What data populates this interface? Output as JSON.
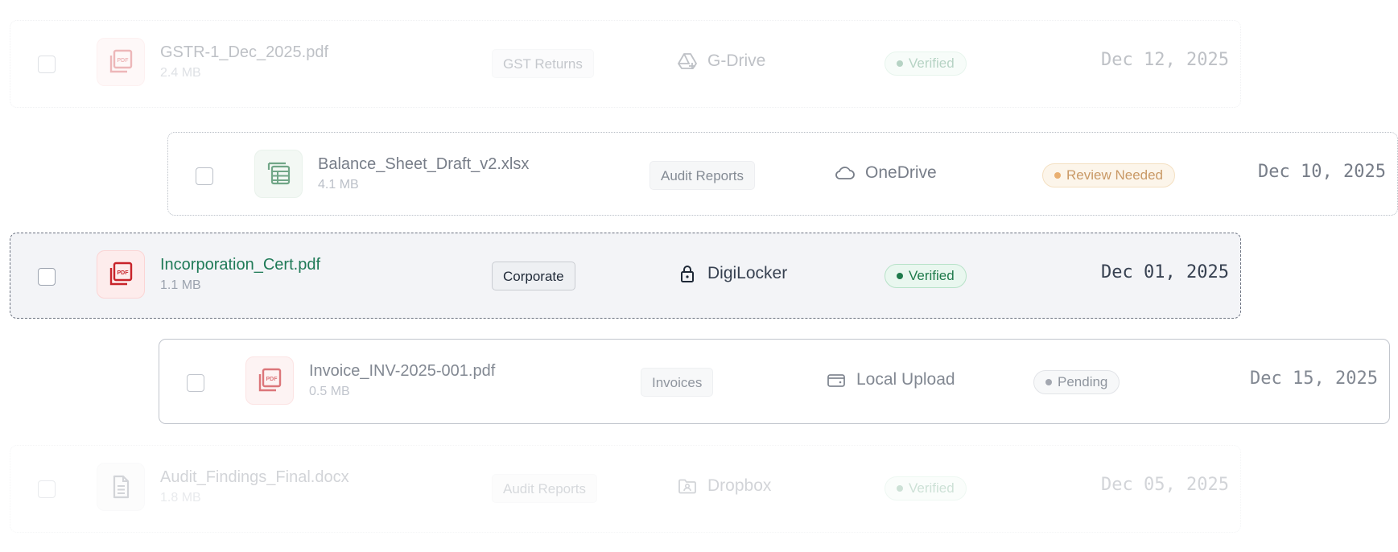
{
  "rows": [
    {
      "name": "GSTR-1_Dec_2025.pdf",
      "size": "2.4 MB",
      "tag": "GST Returns",
      "source": "G-Drive",
      "status": "Verified",
      "date": "Dec 12, 2025",
      "file_type": "pdf",
      "source_icon": "google-drive-icon"
    },
    {
      "name": "Balance_Sheet_Draft_v2.xlsx",
      "size": "4.1 MB",
      "tag": "Audit Reports",
      "source": "OneDrive",
      "status": "Review Needed",
      "date": "Dec 10, 2025",
      "file_type": "xlsx",
      "source_icon": "cloud-icon"
    },
    {
      "name": "Incorporation_Cert.pdf",
      "size": "1.1 MB",
      "tag": "Corporate",
      "source": "DigiLocker",
      "status": "Verified",
      "date": "Dec 01, 2025",
      "file_type": "pdf",
      "source_icon": "lock-icon"
    },
    {
      "name": "Invoice_INV-2025-001.pdf",
      "size": "0.5 MB",
      "tag": "Invoices",
      "source": "Local Upload",
      "status": "Pending",
      "date": "Dec 15, 2025",
      "file_type": "pdf",
      "source_icon": "wallet-icon"
    },
    {
      "name": "Audit_Findings_Final.docx",
      "size": "1.8 MB",
      "tag": "Audit Reports",
      "source": "Dropbox",
      "status": "Verified",
      "date": "Dec 05, 2025",
      "file_type": "docx",
      "source_icon": "folder-user-icon"
    }
  ],
  "colors": {
    "accent": "#1f7a57",
    "pdf_red": "#c8232a",
    "xls_green": "#2f7d4f",
    "verified": "#1f7a4b",
    "review": "#b0691d",
    "pending": "#6b7280"
  }
}
